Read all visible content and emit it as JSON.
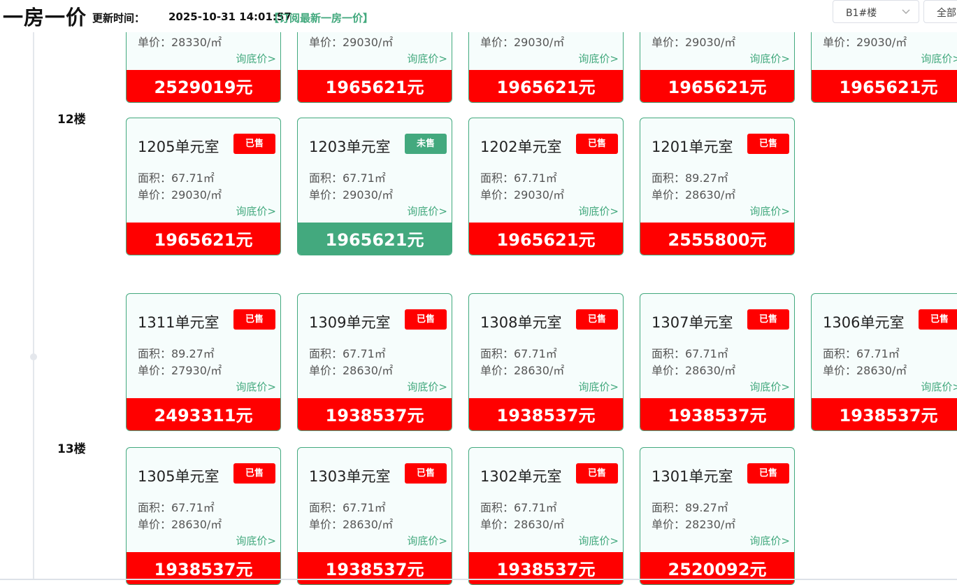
{
  "header": {
    "title": "一房一价",
    "update_label": "更新时间：",
    "update_time": "2025-10-31 14:01:57",
    "subscribe": "【订阅最新一房一价】",
    "building_select": "B1#楼",
    "all_button": "全部"
  },
  "labels": {
    "area_prefix": "面积：",
    "unit_prefix": "单价：",
    "ask": "询底价>"
  },
  "top_partial": [
    {
      "unit_price": "单价：28330/㎡",
      "price": "2529019元"
    },
    {
      "unit_price": "单价：29030/㎡",
      "price": "1965621元"
    },
    {
      "unit_price": "单价：29030/㎡",
      "price": "1965621元"
    },
    {
      "unit_price": "单价：29030/㎡",
      "price": "1965621元"
    },
    {
      "unit_price": "单价：29030/㎡",
      "price": "1965621元"
    }
  ],
  "floors": [
    {
      "label": "12楼",
      "rows": [
        [
          {
            "room": "1205单元室",
            "status": "已售",
            "sold": true,
            "area": "面积：67.71㎡",
            "unit_price": "单价：29030/㎡",
            "price": "1965621元"
          },
          {
            "room": "1203单元室",
            "status": "未售",
            "sold": false,
            "area": "面积：67.71㎡",
            "unit_price": "单价：29030/㎡",
            "price": "1965621元"
          },
          {
            "room": "1202单元室",
            "status": "已售",
            "sold": true,
            "area": "面积：67.71㎡",
            "unit_price": "单价：29030/㎡",
            "price": "1965621元"
          },
          {
            "room": "1201单元室",
            "status": "已售",
            "sold": true,
            "area": "面积：89.27㎡",
            "unit_price": "单价：28630/㎡",
            "price": "2555800元"
          }
        ]
      ]
    },
    {
      "label": "13楼",
      "rows": [
        [
          {
            "room": "1311单元室",
            "status": "已售",
            "sold": true,
            "area": "面积：89.27㎡",
            "unit_price": "单价：27930/㎡",
            "price": "2493311元"
          },
          {
            "room": "1309单元室",
            "status": "已售",
            "sold": true,
            "area": "面积：67.71㎡",
            "unit_price": "单价：28630/㎡",
            "price": "1938537元"
          },
          {
            "room": "1308单元室",
            "status": "已售",
            "sold": true,
            "area": "面积：67.71㎡",
            "unit_price": "单价：28630/㎡",
            "price": "1938537元"
          },
          {
            "room": "1307单元室",
            "status": "已售",
            "sold": true,
            "area": "面积：67.71㎡",
            "unit_price": "单价：28630/㎡",
            "price": "1938537元"
          },
          {
            "room": "1306单元室",
            "status": "已售",
            "sold": true,
            "area": "面积：67.71㎡",
            "unit_price": "单价：28630/㎡",
            "price": "1938537元"
          }
        ],
        [
          {
            "room": "1305单元室",
            "status": "已售",
            "sold": true,
            "area": "面积：67.71㎡",
            "unit_price": "单价：28630/㎡",
            "price": "1938537元"
          },
          {
            "room": "1303单元室",
            "status": "已售",
            "sold": true,
            "area": "面积：67.71㎡",
            "unit_price": "单价：28630/㎡",
            "price": "1938537元"
          },
          {
            "room": "1302单元室",
            "status": "已售",
            "sold": true,
            "area": "面积：67.71㎡",
            "unit_price": "单价：28630/㎡",
            "price": "1938537元"
          },
          {
            "room": "1301单元室",
            "status": "已售",
            "sold": true,
            "area": "面积：89.27㎡",
            "unit_price": "单价：28230/㎡",
            "price": "2520092元"
          }
        ]
      ]
    }
  ],
  "colors": {
    "sold": "#ff0000",
    "unsold": "#43a97e",
    "accent": "#43a97e"
  }
}
